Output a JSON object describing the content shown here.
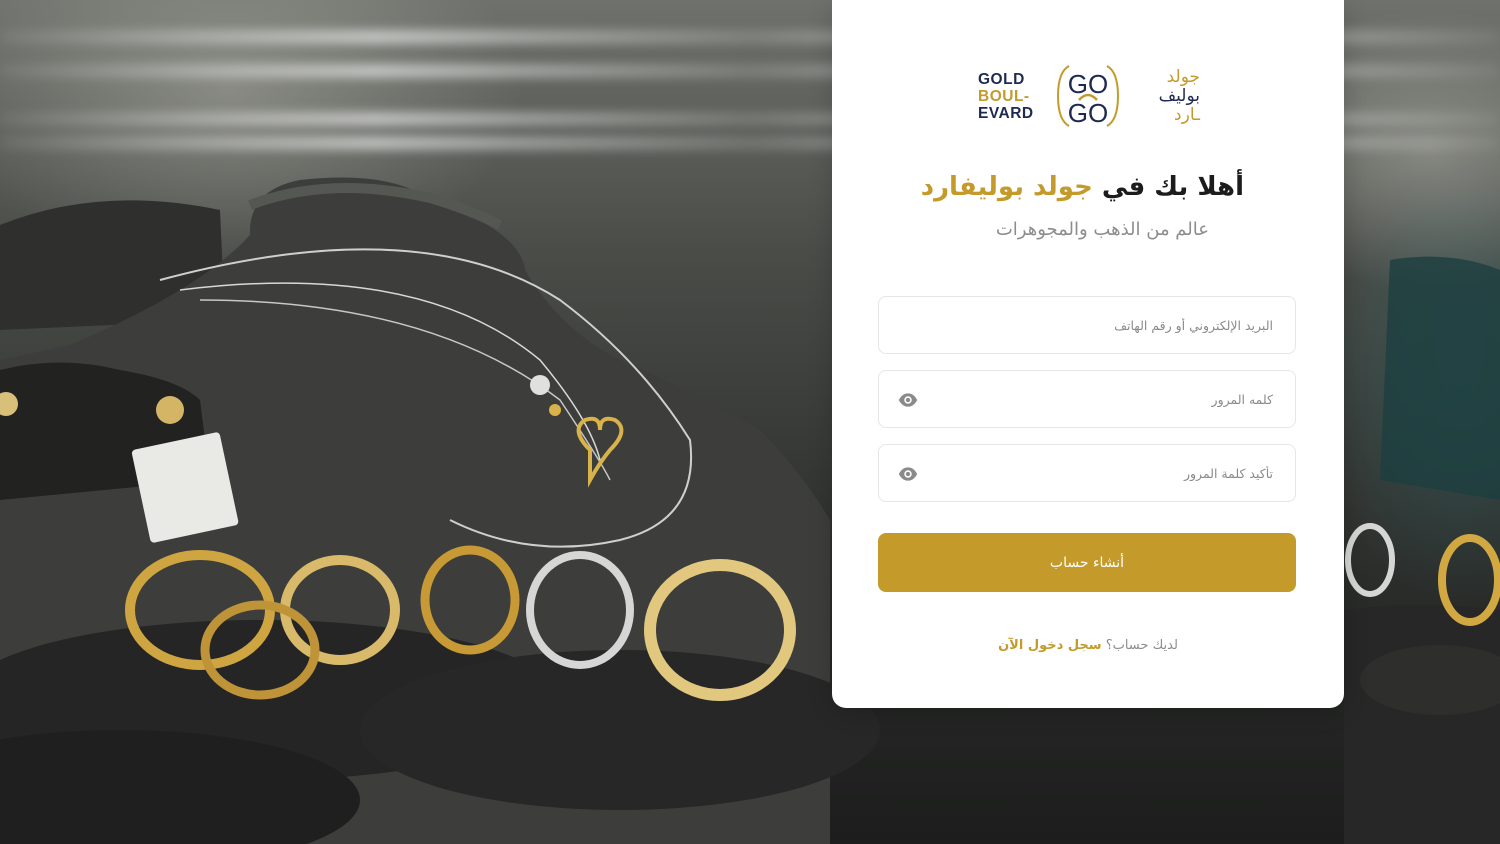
{
  "logo": {
    "en_lines": [
      "GOLD",
      "BOUL-",
      "EVARD"
    ],
    "mark_text": [
      "GO",
      "GO"
    ],
    "ar_lines": [
      "جولد",
      "بوليف",
      "ـارد"
    ]
  },
  "heading": {
    "prefix": "أهلا بك في ",
    "brand": "جولد بوليفارد",
    "subtitle": "عالم من الذهب والمجوهرات"
  },
  "form": {
    "email_placeholder": "البريد الإلكتروني أو رقم الهاتف",
    "password_placeholder": "كلمه المرور",
    "confirm_placeholder": "تأكيد كلمة المرور",
    "submit_label": "أنشاء حساب"
  },
  "footer": {
    "have_account": "لديك حساب؟ ",
    "login_link": "سجل دخول الآن"
  },
  "colors": {
    "accent": "#c49a2a",
    "navy": "#1f2a52",
    "card_bg": "#ffffff",
    "muted_text": "#8d8d8d"
  }
}
